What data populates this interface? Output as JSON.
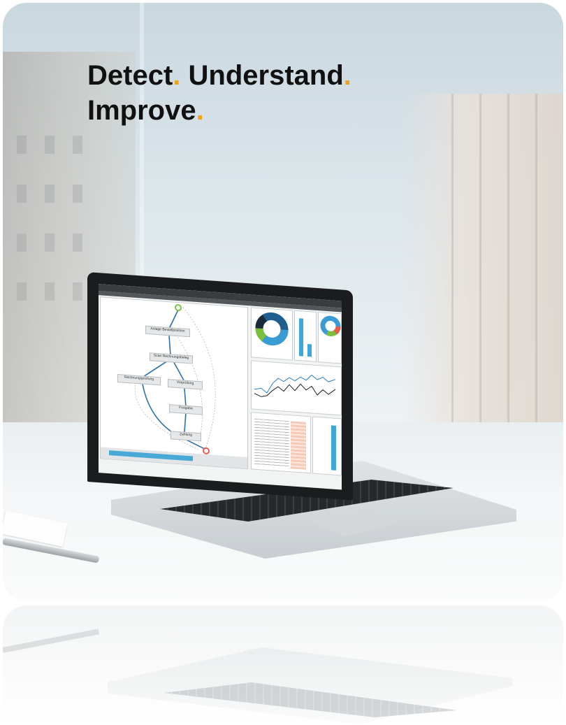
{
  "headline": {
    "word1": "Detect",
    "word2": "Understand",
    "word3": "Improve",
    "punct": ".",
    "accent_color": "#f0a21a",
    "text_color": "#111111"
  },
  "laptop": {
    "screen": {
      "process_nodes": [
        {
          "label": "Anlage Bestellposition"
        },
        {
          "label": "Scan Rechnungsbeleg"
        },
        {
          "label": "Rechnungsprüfung"
        },
        {
          "label": "Vorprüfung"
        },
        {
          "label": "Freigabe"
        },
        {
          "label": "Zahlung"
        }
      ],
      "donut_colors": [
        "#1f5f8f",
        "#3a9bd5",
        "#7bbf3c",
        "#1b2a38",
        "#e85b4b"
      ],
      "line_colors": [
        "#2b7fc0",
        "#1c1c1c"
      ],
      "bar_color": "#3ea6d9"
    }
  }
}
